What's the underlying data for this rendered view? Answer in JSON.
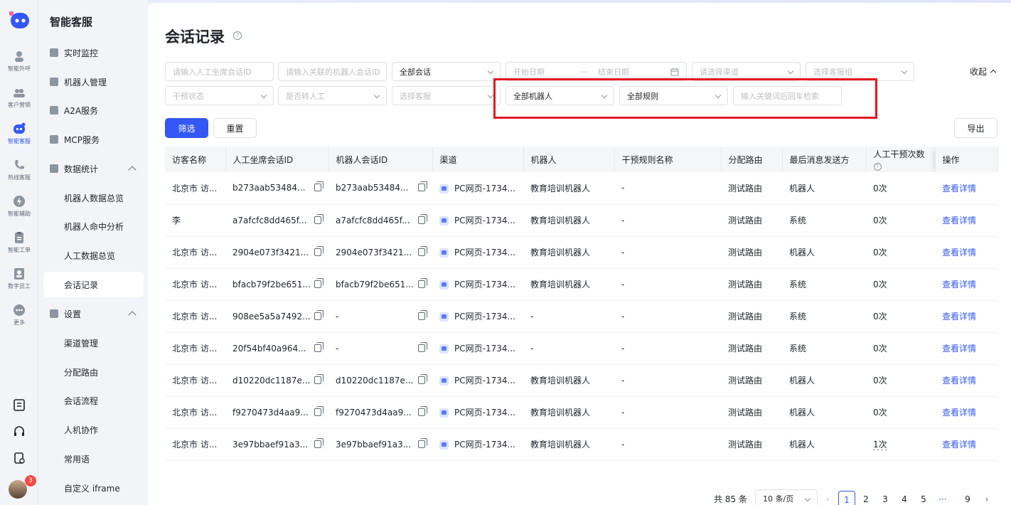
{
  "rail": {
    "items": [
      {
        "label": "智能外呼",
        "icon": "phone-person-icon"
      },
      {
        "label": "客户营销",
        "icon": "people-icon"
      },
      {
        "label": "智能客服",
        "icon": "robot-icon",
        "active": true
      },
      {
        "label": "热线客服",
        "icon": "hotline-icon"
      },
      {
        "label": "智能辅助",
        "icon": "assist-icon"
      },
      {
        "label": "智能工单",
        "icon": "ticket-icon"
      },
      {
        "label": "数字员工",
        "icon": "digital-staff-icon"
      },
      {
        "label": "更多",
        "icon": "more-icon"
      }
    ],
    "notification_count": "3"
  },
  "sidebar": {
    "title": "智能客服",
    "items": [
      {
        "label": "实时监控"
      },
      {
        "label": "机器人管理"
      },
      {
        "label": "A2A服务"
      },
      {
        "label": "MCP服务"
      },
      {
        "label": "数据统计"
      },
      {
        "label": "机器人数据总览"
      },
      {
        "label": "机器人命中分析"
      },
      {
        "label": "人工数据总览"
      },
      {
        "label": "会话记录"
      },
      {
        "label": "设置"
      },
      {
        "label": "渠道管理"
      },
      {
        "label": "分配路由"
      },
      {
        "label": "会话流程"
      },
      {
        "label": "人机协作"
      },
      {
        "label": "常用语"
      },
      {
        "label": "自定义 iframe"
      }
    ]
  },
  "page": {
    "title": "会话记录",
    "help": "?"
  },
  "filters": {
    "agent_session_id": "请输入人工坐席会话ID",
    "robot_session_id": "请输入关联的机器人会话ID",
    "session_type": "全部会话",
    "start_date": "开始日期",
    "date_sep": "—",
    "end_date": "结束日期",
    "channel": "请选择渠道",
    "agent_group": "选择客服组",
    "intervention_state": "干预状态",
    "transfer_human": "是否转人工",
    "agent": "选择客服",
    "robot": "全部机器人",
    "rule": "全部规则",
    "keyword": "输入关键词后回车检索",
    "collapse": "收起"
  },
  "actions": {
    "filter": "筛选",
    "reset": "重置",
    "export": "导出"
  },
  "table": {
    "headers": [
      "访客名称",
      "人工坐席会话ID",
      "机器人会话ID",
      "渠道",
      "机器人",
      "干预规则名称",
      "分配路由",
      "最后消息发送方",
      "人工干预次数",
      "操作"
    ],
    "rows": [
      [
        "北京市 访...",
        "b273aab53484...",
        "b273aab53484...",
        "PC网页-1734...",
        "教育培训机器人",
        "-",
        "测试路由",
        "机器人",
        "0次",
        "查看详情"
      ],
      [
        "李",
        "a7afcfc8dd465f...",
        "a7afcfc8dd465f...",
        "PC网页-1734...",
        "教育培训机器人",
        "-",
        "测试路由",
        "系统",
        "0次",
        "查看详情"
      ],
      [
        "北京市 访...",
        "2904e073f3421...",
        "2904e073f3421...",
        "PC网页-1734...",
        "教育培训机器人",
        "-",
        "测试路由",
        "机器人",
        "0次",
        "查看详情"
      ],
      [
        "北京市 访...",
        "bfacb79f2be651...",
        "bfacb79f2be651...",
        "PC网页-1734...",
        "教育培训机器人",
        "-",
        "测试路由",
        "系统",
        "0次",
        "查看详情"
      ],
      [
        "北京市 访...",
        "908ee5a5a7492...",
        "-",
        "PC网页-1734...",
        "-",
        "-",
        "测试路由",
        "系统",
        "0次",
        "查看详情"
      ],
      [
        "北京市 访...",
        "20f54bf40a964...",
        "-",
        "PC网页-1734...",
        "-",
        "-",
        "测试路由",
        "系统",
        "0次",
        "查看详情"
      ],
      [
        "北京市 访...",
        "d10220dc1187e...",
        "d10220dc1187e...",
        "PC网页-1734...",
        "教育培训机器人",
        "-",
        "测试路由",
        "机器人",
        "0次",
        "查看详情"
      ],
      [
        "北京市 访...",
        "f9270473d4aa9...",
        "f9270473d4aa9...",
        "PC网页-1734...",
        "教育培训机器人",
        "-",
        "测试路由",
        "机器人",
        "0次",
        "查看详情"
      ],
      [
        "北京市 访...",
        "3e97bbaef91a3...",
        "3e97bbaef91a3...",
        "PC网页-1734...",
        "教育培训机器人",
        "-",
        "测试路由",
        "机器人",
        "1次",
        "查看详情"
      ]
    ]
  },
  "pagination": {
    "total": "共 85 条",
    "page_size": "10 条/页",
    "pages": [
      "1",
      "2",
      "3",
      "4",
      "5",
      "···",
      "9"
    ],
    "current": "1"
  },
  "colors": {
    "primary": "#3457f5",
    "highlight": "#e5181f"
  }
}
